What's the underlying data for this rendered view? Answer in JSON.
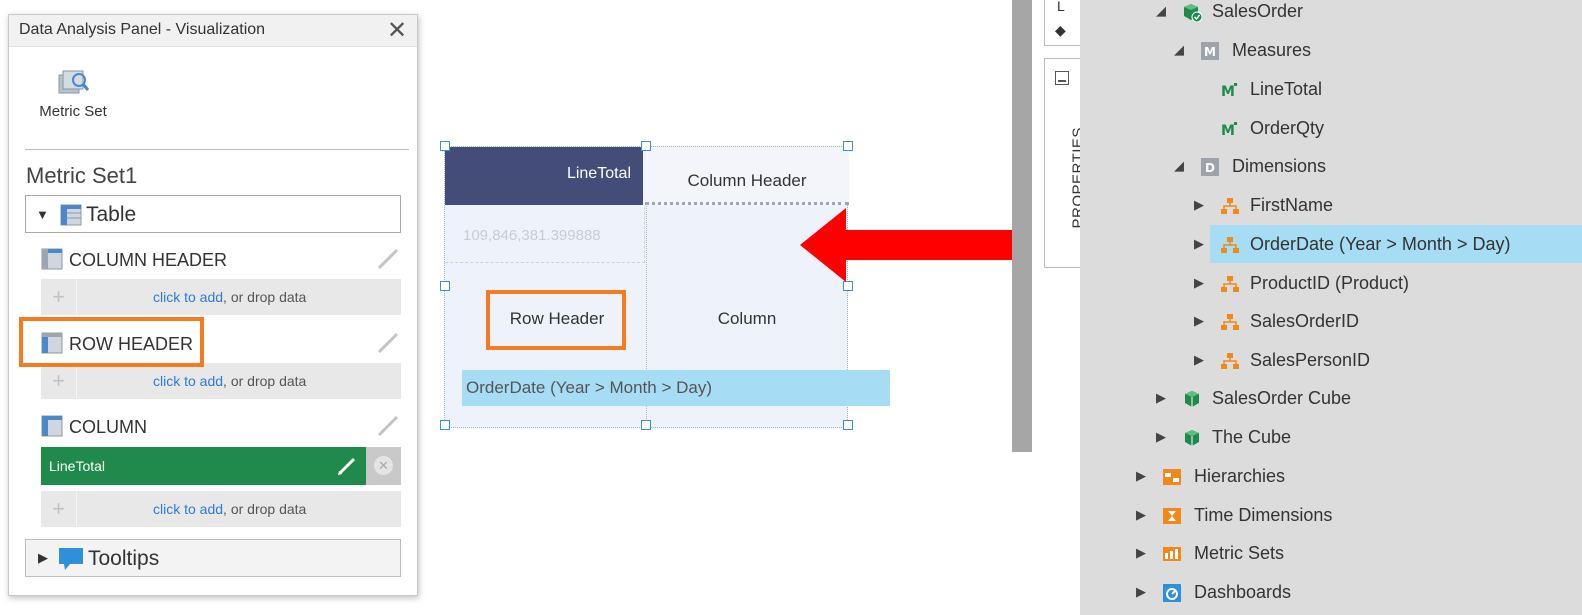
{
  "panel": {
    "title": "Data Analysis Panel - Visualization",
    "close_glyph": "✕",
    "metric_set_button": "Metric Set",
    "metric_set_name": "Metric Set1",
    "visualization": "Table",
    "sections": {
      "column_header": "COLUMN HEADER",
      "row_header": "ROW HEADER",
      "column": "COLUMN"
    },
    "drop_hint_link": "click to add",
    "drop_hint_rest": ", or drop data",
    "column_field": "LineTotal",
    "tooltips": "Tooltips"
  },
  "preview": {
    "line_total": "LineTotal",
    "column_header": "Column Header",
    "value": "109,846,381.399888",
    "row_header": "Row Header",
    "column": "Column",
    "drag_item": "OrderDate (Year > Month > Day)"
  },
  "side_tabs": {
    "top_letter": "L",
    "properties": "PROPERTIES"
  },
  "tree": {
    "sales_order": "SalesOrder",
    "measures": "Measures",
    "line_total": "LineTotal",
    "order_qty": "OrderQty",
    "dimensions": "Dimensions",
    "first_name": "FirstName",
    "order_date": "OrderDate (Year > Month > Day)",
    "product_id": "ProductID (Product)",
    "sales_order_id": "SalesOrderID",
    "sales_person_id": "SalesPersonID",
    "sales_order_cube": "SalesOrder Cube",
    "the_cube": "The Cube",
    "hierarchies": "Hierarchies",
    "time_dimensions": "Time Dimensions",
    "metric_sets": "Metric Sets",
    "dashboards": "Dashboards"
  },
  "colors": {
    "accent_orange": "#f47b20",
    "field_green": "#1f8a4c",
    "header_navy": "#434d77",
    "selection_blue": "#a6dcf4",
    "arrow_red": "#ff0000"
  }
}
